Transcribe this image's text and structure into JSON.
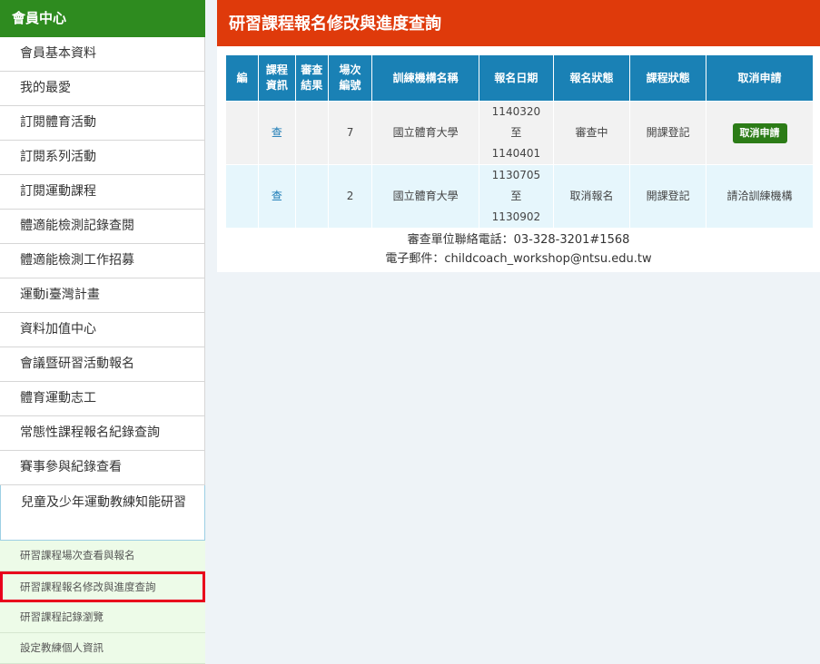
{
  "sidebar": {
    "header": "會員中心",
    "items": [
      "會員基本資料",
      "我的最愛",
      "訂閱體育活動",
      "訂閱系列活動",
      "訂閱運動課程",
      "體適能檢測記錄查閱",
      "體適能檢測工作招募",
      "運動i臺灣計畫",
      "資料加值中心",
      "會議暨研習活動報名",
      "體育運動志工",
      "常態性課程報名紀錄查詢",
      "賽事參與紀錄查看",
      "兒童及少年運動教練知能研習"
    ],
    "subitems": [
      "研習課程場次查看與報名",
      "研習課程報名修改與進度查詢",
      "研習課程記錄瀏覽",
      "設定教練個人資訊"
    ]
  },
  "main": {
    "title": "研習課程報名修改與進度查詢",
    "table": {
      "headers": [
        "編",
        "課程\n資訊",
        "審查\n結果",
        "場次\n編號",
        "訓練機構名稱",
        "報名日期",
        "報名狀態",
        "課程狀態",
        "取消申請"
      ],
      "rows": [
        {
          "info": "查",
          "review": "",
          "session": "7",
          "org": "國立體育大學",
          "date": "1140320\n至\n1140401",
          "reg_status": "審查中",
          "course_status": "開課登記",
          "cancel": "取消申請"
        },
        {
          "info": "查",
          "review": "",
          "session": "2",
          "org": "國立體育大學",
          "date": "1130705\n至\n1130902",
          "reg_status": "取消報名",
          "course_status": "開課登記",
          "cancel": "請洽訓練機構"
        }
      ]
    },
    "contact_phone": "審查單位聯絡電話：03-328-3201#1568",
    "contact_email": "電子郵件：childcoach_workshop@ntsu.edu.tw"
  },
  "colors": {
    "sidebar_header": "#2e8b1f",
    "title_bar": "#df3a0b",
    "table_header": "#1a81b5",
    "cancel_button": "#2c7c17",
    "selected_outline": "#e8001c"
  }
}
